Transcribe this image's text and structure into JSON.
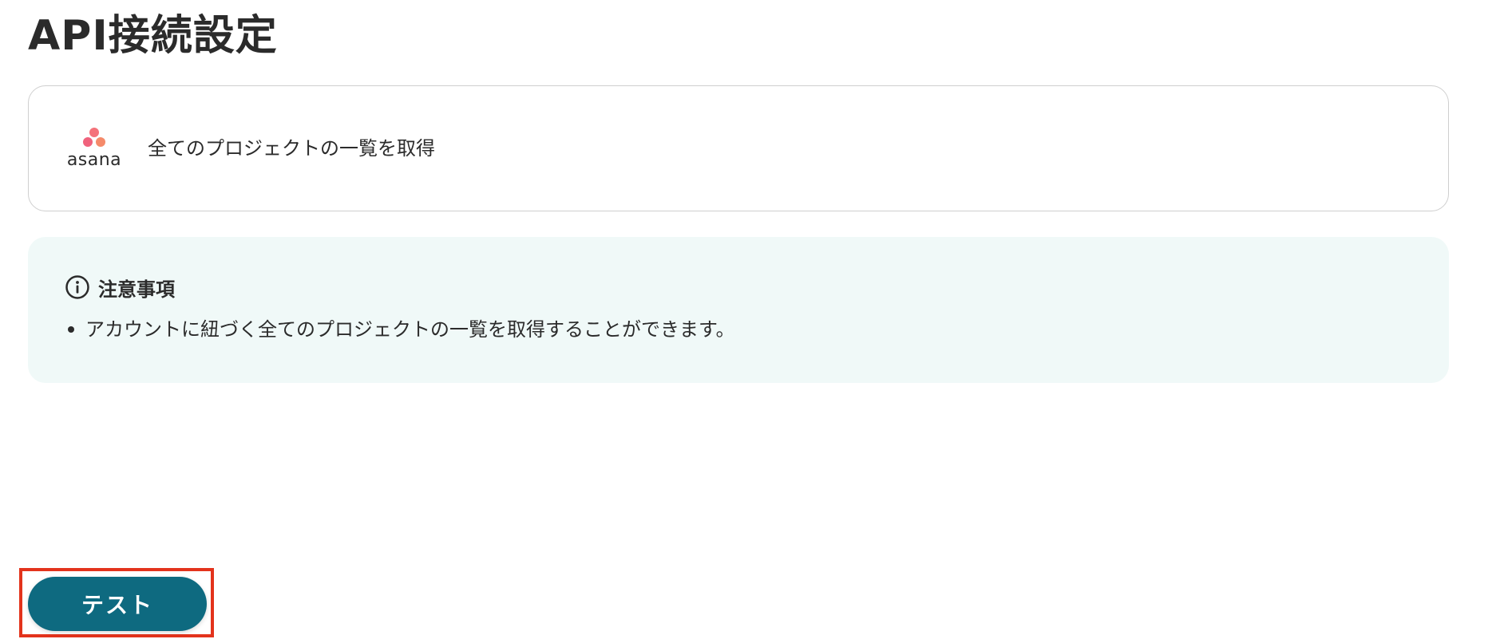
{
  "page": {
    "title": "API接続設定"
  },
  "action": {
    "app_name": "asana",
    "app_logo_icon": "asana-logo-icon",
    "label": "全てのプロジェクトの一覧を取得"
  },
  "notice": {
    "icon": "info-icon",
    "title": "注意事項",
    "items": [
      "アカウントに紐づく全てのプロジェクトの一覧を取得することができます。"
    ]
  },
  "footer": {
    "test_button_label": "テスト"
  },
  "colors": {
    "primary_button": "#0e6a80",
    "notice_background": "#f0f9f8",
    "highlight_border": "#e3331c",
    "asana_brand": "#f06a6a"
  }
}
